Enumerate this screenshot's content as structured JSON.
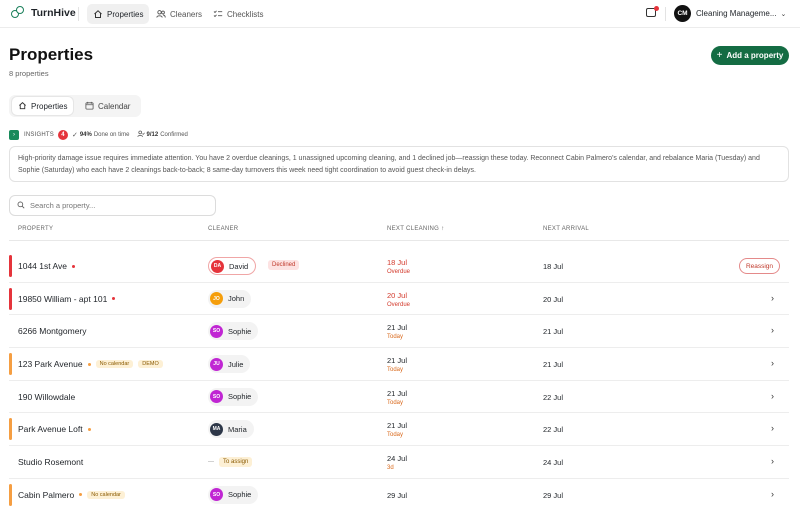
{
  "app": {
    "name": "TurnHive"
  },
  "nav": {
    "tabs": [
      {
        "label": "Properties",
        "icon": "home-icon"
      },
      {
        "label": "Cleaners",
        "icon": "users-icon"
      },
      {
        "label": "Checklists",
        "icon": "list-icon"
      }
    ]
  },
  "org": {
    "initials": "CM",
    "name": "Cleaning Manageme..."
  },
  "header": {
    "title": "Properties",
    "subtitle": "8 properties",
    "add_label": "Add a property"
  },
  "view_tabs": [
    {
      "label": "Properties",
      "icon": "home-icon"
    },
    {
      "label": "Calendar",
      "icon": "calendar-icon"
    }
  ],
  "insights": {
    "label": "INSIGHTS",
    "count": "4",
    "done_value": "94%",
    "done_label": "Done on time",
    "confirmed_value": "9/12",
    "confirmed_label": "Confirmed",
    "summary": "High-priority damage issue requires immediate attention. You have 2 overdue cleanings, 1 unassigned upcoming cleaning, and 1 declined job—reassign these today. Reconnect Cabin Palmero's calendar, and rebalance Maria (Tuesday) and Sophie (Saturday) who each have 2 cleanings back-to-back; 8 same-day turnovers this week need tight coordination to avoid guest check-in delays."
  },
  "search": {
    "placeholder": "Search a property..."
  },
  "table": {
    "headers": {
      "property": "PROPERTY",
      "cleaner": "CLEANER",
      "next_cleaning": "NEXT CLEANING ↑",
      "next_arrival": "NEXT ARRIVAL"
    },
    "reassign_label": "Reassign",
    "declined_label": "Declined",
    "to_assign_label": "To assign",
    "unassigned_dash": "—",
    "rows": [
      {
        "property": "1044 1st Ave",
        "cleaner_initials": "DA",
        "cleaner": "David",
        "next": "18 Jul",
        "next_sub": "Overdue",
        "arrival": "18 Jul"
      },
      {
        "property": "19850 William - apt 101",
        "cleaner_initials": "JO",
        "cleaner": "John",
        "next": "20 Jul",
        "next_sub": "Overdue",
        "arrival": "20 Jul"
      },
      {
        "property": "6266 Montgomery",
        "cleaner_initials": "SO",
        "cleaner": "Sophie",
        "next": "21 Jul",
        "next_sub": "Today",
        "arrival": "21 Jul"
      },
      {
        "property": "123 Park Avenue",
        "tag1": "No calendar",
        "tag2": "DEMO",
        "cleaner_initials": "JU",
        "cleaner": "Julie",
        "next": "21 Jul",
        "next_sub": "Today",
        "arrival": "21 Jul"
      },
      {
        "property": "190 Willowdale",
        "cleaner_initials": "SO",
        "cleaner": "Sophie",
        "next": "21 Jul",
        "next_sub": "Today",
        "arrival": "22 Jul"
      },
      {
        "property": "Park Avenue Loft",
        "cleaner_initials": "MA",
        "cleaner": "Maria",
        "next": "21 Jul",
        "next_sub": "Today",
        "arrival": "22 Jul"
      },
      {
        "property": "Studio Rosemont",
        "next": "24 Jul",
        "next_sub": "3d",
        "arrival": "24 Jul"
      },
      {
        "property": "Cabin Palmero",
        "tag1": "No calendar",
        "cleaner_initials": "SO",
        "cleaner": "Sophie",
        "next": "29 Jul",
        "arrival": "29 Jul"
      }
    ]
  },
  "colors": {
    "brand": "#1a7f5a",
    "primary_button": "#146c43",
    "alert_red": "#e5343b",
    "warning_orange": "#f59e42",
    "avatar_david": "#e5343b",
    "avatar_john": "#f59e0b",
    "avatar_sophie": "#c026d3",
    "avatar_julie": "#c026d3",
    "avatar_maria": "#2d3748"
  }
}
